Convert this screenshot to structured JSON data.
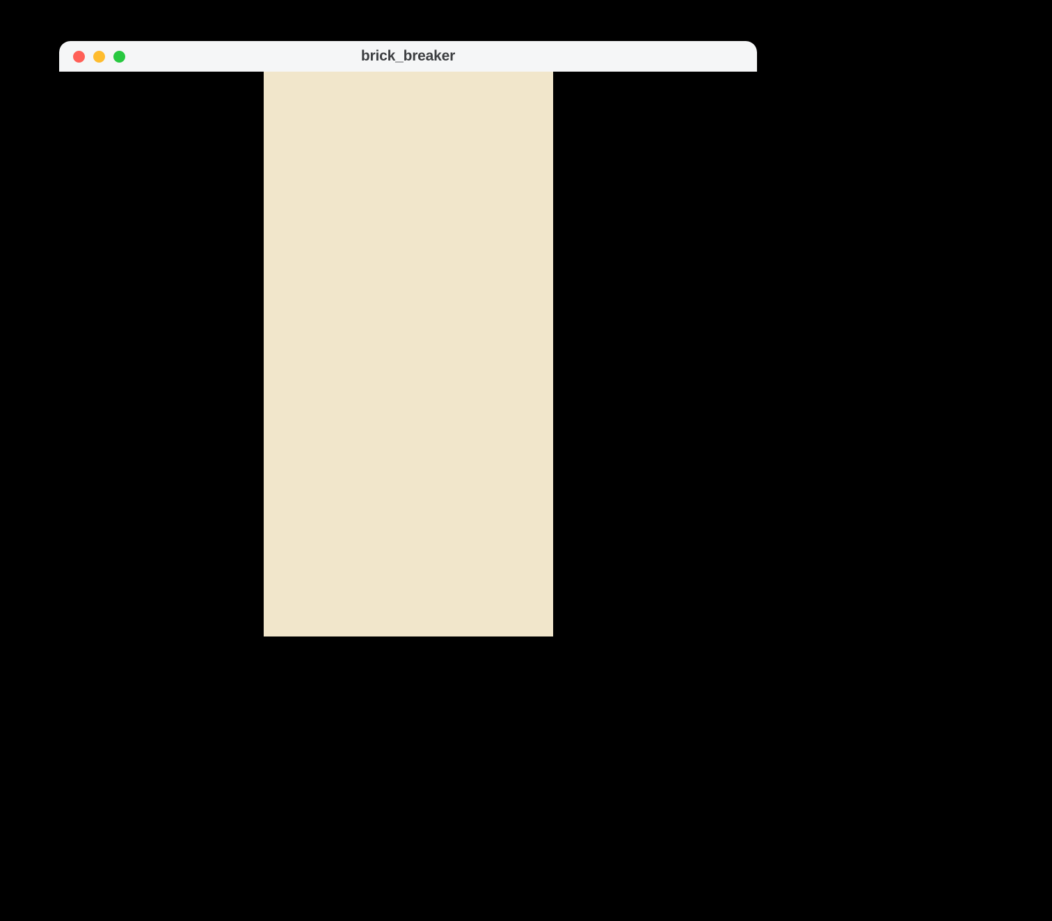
{
  "window": {
    "title": "brick_breaker"
  },
  "traffic_lights": {
    "close": "close-icon",
    "minimize": "minimize-icon",
    "zoom": "zoom-icon"
  },
  "colors": {
    "desktop_background": "#000000",
    "window_background": "#000000",
    "titlebar_background": "#f5f6f7",
    "title_text": "#3d3f42",
    "game_canvas_background": "#f1e6cb",
    "traffic_close": "#ff5f57",
    "traffic_minimize": "#febc2e",
    "traffic_zoom": "#28c840"
  }
}
